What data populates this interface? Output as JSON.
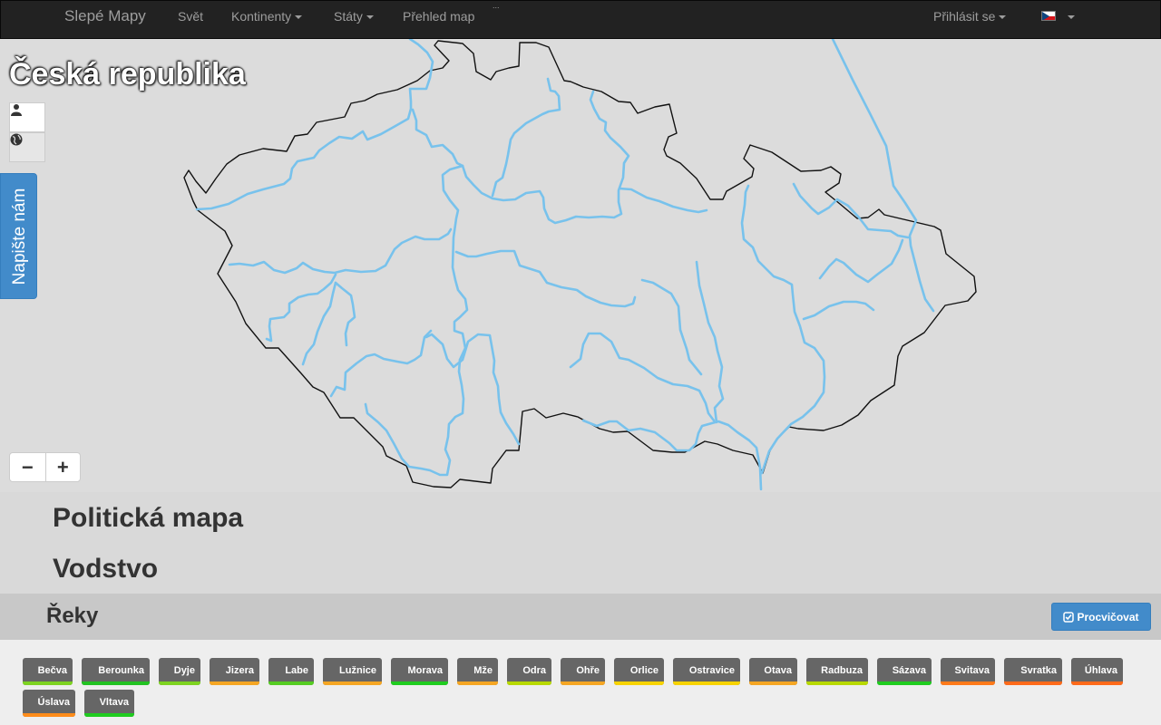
{
  "navbar": {
    "brand": "Slepé Mapy",
    "items": [
      "Svět",
      "Kontinenty",
      "Státy",
      "Přehled map"
    ],
    "login": "Přihlásit se",
    "ellipsis": "..."
  },
  "map": {
    "title": "Česká republika",
    "user_icon": "user-icon",
    "globe_icon": "globe-icon",
    "zoom_out": "−",
    "zoom_in": "+"
  },
  "feedback": {
    "label": "Napište nám"
  },
  "sections": [
    {
      "title": "Politická mapa"
    },
    {
      "title": "Vodstvo"
    }
  ],
  "subsection": {
    "title": "Řeky",
    "practice_button": "Procvičovat",
    "practice_icon": "check-square-icon"
  },
  "rivers": [
    {
      "name": "Bečva",
      "color": "#7ed321"
    },
    {
      "name": "Berounka",
      "color": "#22c222"
    },
    {
      "name": "Dyje",
      "color": "#7ed321"
    },
    {
      "name": "Jizera",
      "color": "#f5a623"
    },
    {
      "name": "Labe",
      "color": "#55cc22"
    },
    {
      "name": "Lužnice",
      "color": "#f5a623"
    },
    {
      "name": "Morava",
      "color": "#1fcc1f"
    },
    {
      "name": "Mže",
      "color": "#f5a623"
    },
    {
      "name": "Odra",
      "color": "#b8d900"
    },
    {
      "name": "Ohře",
      "color": "#f5a623"
    },
    {
      "name": "Orlice",
      "color": "#f8d300"
    },
    {
      "name": "Ostravice",
      "color": "#f8d300"
    },
    {
      "name": "Otava",
      "color": "#f5a623"
    },
    {
      "name": "Radbuza",
      "color": "#b8d900"
    },
    {
      "name": "Sázava",
      "color": "#1fcc1f"
    },
    {
      "name": "Svitava",
      "color": "#ff7a1a"
    },
    {
      "name": "Svratka",
      "color": "#ff6a1a"
    },
    {
      "name": "Úhlava",
      "color": "#ff6a1a"
    },
    {
      "name": "Úslava",
      "color": "#ff8c1a"
    },
    {
      "name": "Vltava",
      "color": "#1fcc1f"
    }
  ],
  "colors": {
    "river": "#78c2ec",
    "border": "#111111",
    "primary": "#428bca"
  }
}
